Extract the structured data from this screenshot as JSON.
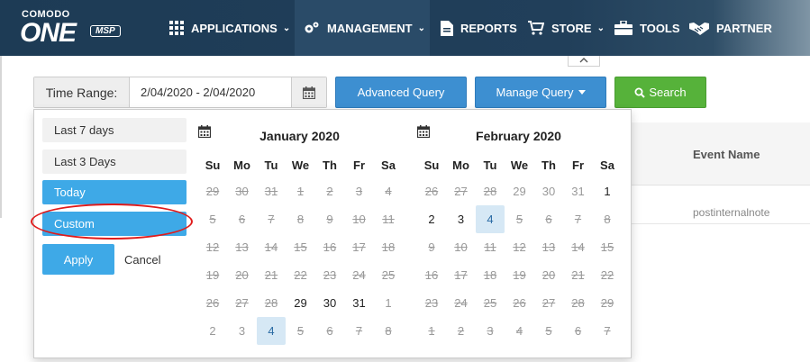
{
  "logo": {
    "brand": "COMODO",
    "product": "ONE",
    "badge": "MSP"
  },
  "nav": [
    {
      "label": "APPLICATIONS",
      "icon": "grid-icon",
      "chevron": "⌄"
    },
    {
      "label": "MANAGEMENT",
      "icon": "gears-icon",
      "chevron": "⌄"
    },
    {
      "label": "REPORTS",
      "icon": "report-icon",
      "chevron": ""
    },
    {
      "label": "STORE",
      "icon": "cart-icon",
      "chevron": "⌄"
    },
    {
      "label": "TOOLS",
      "icon": "toolbox-icon",
      "chevron": ""
    },
    {
      "label": "PARTNER",
      "icon": "handshake-icon",
      "chevron": ""
    }
  ],
  "filter": {
    "time_range_label": "Time Range:",
    "time_range_value": "2/04/2020 - 2/04/2020",
    "advanced_query": "Advanced Query",
    "manage_query": "Manage Query",
    "search": "Search"
  },
  "table": {
    "event_name_header": "Event Name",
    "event_cell": "postinternalnote"
  },
  "ranges": {
    "last7": "Last 7 days",
    "last3": "Last 3 Days",
    "today": "Today",
    "custom": "Custom",
    "apply": "Apply",
    "cancel": "Cancel"
  },
  "weekdays": [
    "Su",
    "Mo",
    "Tu",
    "We",
    "Th",
    "Fr",
    "Sa"
  ],
  "calendars": [
    {
      "title": "January 2020",
      "weeks": [
        [
          [
            "29",
            "off"
          ],
          [
            "30",
            "off"
          ],
          [
            "31",
            "off"
          ],
          [
            "1",
            "off"
          ],
          [
            "2",
            "off"
          ],
          [
            "3",
            "off"
          ],
          [
            "4",
            "off"
          ]
        ],
        [
          [
            "5",
            "off"
          ],
          [
            "6",
            "off"
          ],
          [
            "7",
            "off"
          ],
          [
            "8",
            "off"
          ],
          [
            "9",
            "off"
          ],
          [
            "10",
            "off"
          ],
          [
            "11",
            "off"
          ]
        ],
        [
          [
            "12",
            "off"
          ],
          [
            "13",
            "off"
          ],
          [
            "14",
            "off"
          ],
          [
            "15",
            "off"
          ],
          [
            "16",
            "off"
          ],
          [
            "17",
            "off"
          ],
          [
            "18",
            "off"
          ]
        ],
        [
          [
            "19",
            "off"
          ],
          [
            "20",
            "off"
          ],
          [
            "21",
            "off"
          ],
          [
            "22",
            "off"
          ],
          [
            "23",
            "off"
          ],
          [
            "24",
            "off"
          ],
          [
            "25",
            "off"
          ]
        ],
        [
          [
            "26",
            "off"
          ],
          [
            "27",
            "off"
          ],
          [
            "28",
            "off"
          ],
          [
            "29",
            "on"
          ],
          [
            "30",
            "on"
          ],
          [
            "31",
            "on"
          ],
          [
            "1",
            "grey"
          ]
        ],
        [
          [
            "2",
            "grey"
          ],
          [
            "3",
            "grey"
          ],
          [
            "4",
            "sel"
          ],
          [
            "5",
            "off"
          ],
          [
            "6",
            "off"
          ],
          [
            "7",
            "off"
          ],
          [
            "8",
            "off"
          ]
        ]
      ]
    },
    {
      "title": "February 2020",
      "weeks": [
        [
          [
            "26",
            "off"
          ],
          [
            "27",
            "off"
          ],
          [
            "28",
            "off"
          ],
          [
            "29",
            "grey"
          ],
          [
            "30",
            "grey"
          ],
          [
            "31",
            "grey"
          ],
          [
            "1",
            "on"
          ]
        ],
        [
          [
            "2",
            "on"
          ],
          [
            "3",
            "on"
          ],
          [
            "4",
            "sel"
          ],
          [
            "5",
            "off"
          ],
          [
            "6",
            "off"
          ],
          [
            "7",
            "off"
          ],
          [
            "8",
            "off"
          ]
        ],
        [
          [
            "9",
            "off"
          ],
          [
            "10",
            "off"
          ],
          [
            "11",
            "off"
          ],
          [
            "12",
            "off"
          ],
          [
            "13",
            "off"
          ],
          [
            "14",
            "off"
          ],
          [
            "15",
            "off"
          ]
        ],
        [
          [
            "16",
            "off"
          ],
          [
            "17",
            "off"
          ],
          [
            "18",
            "off"
          ],
          [
            "19",
            "off"
          ],
          [
            "20",
            "off"
          ],
          [
            "21",
            "off"
          ],
          [
            "22",
            "off"
          ]
        ],
        [
          [
            "23",
            "off"
          ],
          [
            "24",
            "off"
          ],
          [
            "25",
            "off"
          ],
          [
            "26",
            "off"
          ],
          [
            "27",
            "off"
          ],
          [
            "28",
            "off"
          ],
          [
            "29",
            "off"
          ]
        ],
        [
          [
            "1",
            "off"
          ],
          [
            "2",
            "off"
          ],
          [
            "3",
            "off"
          ],
          [
            "4",
            "off"
          ],
          [
            "5",
            "off"
          ],
          [
            "6",
            "off"
          ],
          [
            "7",
            "off"
          ]
        ]
      ]
    }
  ],
  "colors": {
    "nav_bg": "#1d3b55",
    "primary": "#3d8fd1",
    "success": "#56b23a",
    "range_active": "#3ea9e7",
    "highlight": "#e01b1b"
  }
}
